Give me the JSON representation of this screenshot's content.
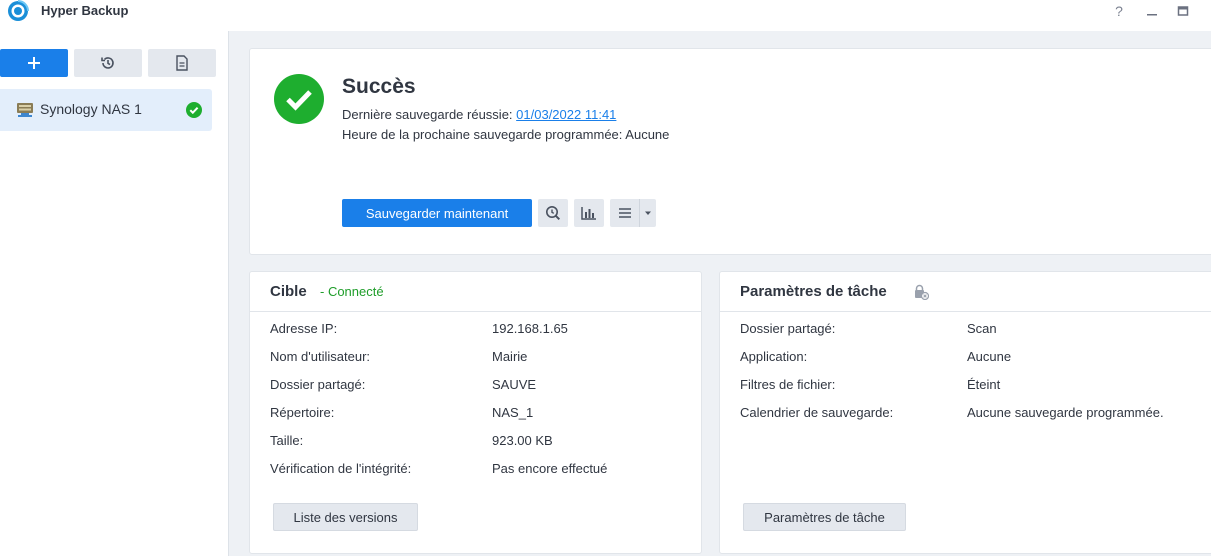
{
  "app": {
    "title": "Hyper Backup"
  },
  "window": {
    "help": "?",
    "minimize": "—",
    "maximize": "▭"
  },
  "sidebar": {
    "items": [
      {
        "label": "Synology NAS 1",
        "status": "success"
      }
    ]
  },
  "status": {
    "title": "Succès",
    "last_backup_label": "Dernière sauvegarde réussie: ",
    "last_backup_value": "01/03/2022 11:41",
    "next_backup_label": "Heure de la prochaine sauvegarde programmée: ",
    "next_backup_value": "Aucune",
    "backup_now_label": "Sauvegarder maintenant"
  },
  "target": {
    "title": "Cible",
    "state": "- Connecté",
    "rows": [
      {
        "label": "Adresse IP:",
        "value": "192.168.1.65"
      },
      {
        "label": "Nom d'utilisateur:",
        "value": "Mairie"
      },
      {
        "label": "Dossier partagé:",
        "value": "SAUVE"
      },
      {
        "label": "Répertoire:",
        "value": "NAS_1"
      },
      {
        "label": "Taille:",
        "value": "923.00 KB"
      },
      {
        "label": "Vérification de l'intégrité:",
        "value": "Pas encore effectué"
      }
    ],
    "versions_button": "Liste des versions"
  },
  "task": {
    "title": "Paramètres de tâche",
    "rows": [
      {
        "label": "Dossier partagé:",
        "value": "Scan"
      },
      {
        "label": "Application:",
        "value": "Aucune"
      },
      {
        "label": "Filtres de fichier:",
        "value": "Éteint"
      },
      {
        "label": "Calendrier de sauvegarde:",
        "value": "Aucune sauvegarde programmée."
      }
    ],
    "settings_button": "Paramètres de tâche"
  },
  "colors": {
    "accent": "#1a7fe9",
    "success": "#1eae2f",
    "connected": "#1f9d2a"
  }
}
